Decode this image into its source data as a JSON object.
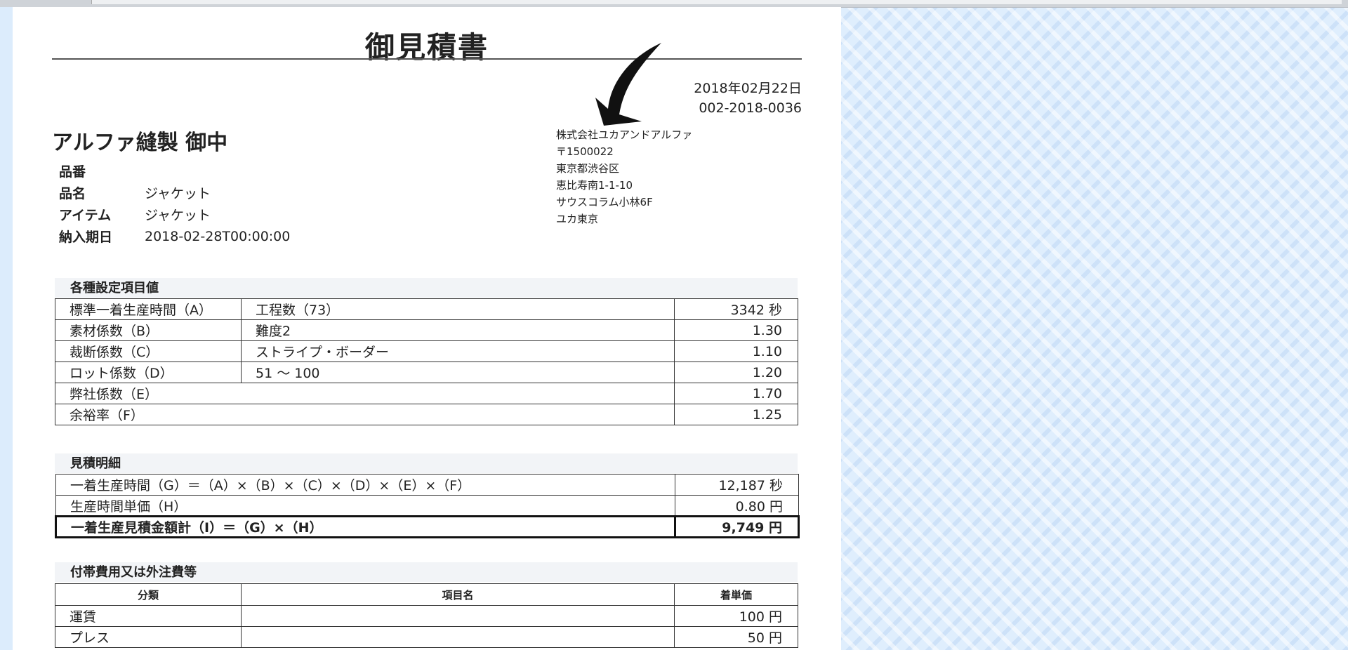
{
  "document": {
    "title": "御見積書",
    "date": "2018年02月22日",
    "number": "002-2018-0036"
  },
  "sender": {
    "lines": [
      "株式会社ユカアンドアルファ",
      "〒1500022",
      "東京都渋谷区",
      "恵比寿南1-1-10",
      "サウスコラム小林6F",
      "ユカ東京"
    ]
  },
  "customer": {
    "name": "アルファ縫製 御中",
    "fields": [
      {
        "label": "品番",
        "value": ""
      },
      {
        "label": "品名",
        "value": "ジャケット"
      },
      {
        "label": "アイテム",
        "value": "ジャケット"
      },
      {
        "label": "納入期日",
        "value": "2018-02-28T00:00:00"
      }
    ]
  },
  "settings": {
    "heading": "各種設定項目値",
    "rows": [
      {
        "label": "標準一着生産時間（A）",
        "detail": "工程数（73）",
        "value": "3342 秒"
      },
      {
        "label": "素材係数（B）",
        "detail": "難度2",
        "value": "1.30"
      },
      {
        "label": "裁断係数（C）",
        "detail": "ストライプ・ボーダー",
        "value": "1.10"
      },
      {
        "label": "ロット係数（D）",
        "detail": "51 ～ 100",
        "value": "1.20"
      },
      {
        "label": "弊社係数（E）",
        "value": "1.70"
      },
      {
        "label": "余裕率（F）",
        "value": "1.25"
      }
    ]
  },
  "estimate": {
    "heading": "見積明細",
    "rows": [
      {
        "label": "一着生産時間（G）＝（A）×（B）×（C）×（D）×（E）×（F）",
        "value": "12,187 秒"
      },
      {
        "label": "生産時間単価（H）",
        "value": "0.80 円"
      },
      {
        "label": "一着生産見積金額計（I）＝（G）×（H）",
        "value": "9,749 円"
      }
    ]
  },
  "extras": {
    "heading": "付帯費用又は外注費等",
    "columns": [
      "分類",
      "項目名",
      "着単価"
    ],
    "rows": [
      {
        "category": "運賃",
        "item": "",
        "price": "100 円"
      },
      {
        "category": "プレス",
        "item": "",
        "price": "50 円"
      }
    ]
  }
}
